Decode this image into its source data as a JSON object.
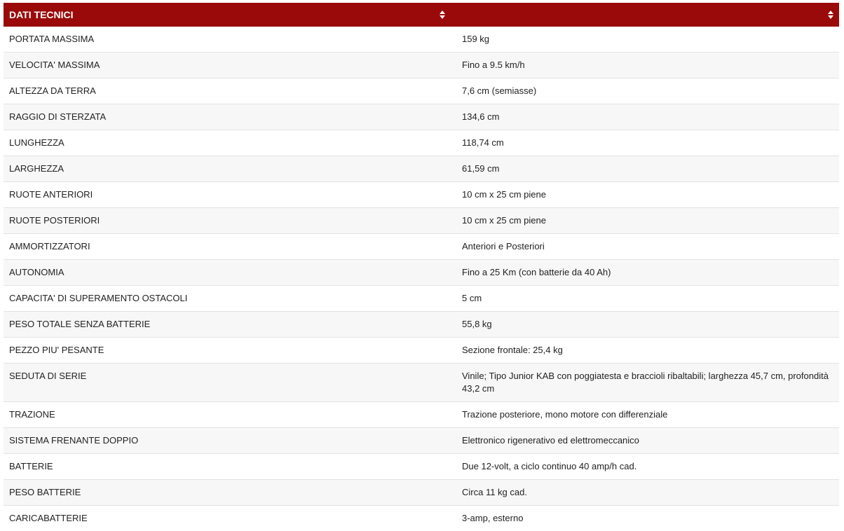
{
  "table": {
    "headers": [
      "DATI TECNICI",
      ""
    ],
    "rows": [
      {
        "label": "PORTATA MASSIMA",
        "value": "159 kg"
      },
      {
        "label": "VELOCITA' MASSIMA",
        "value": "Fino a 9.5 km/h"
      },
      {
        "label": "ALTEZZA DA TERRA",
        "value": "7,6 cm (semiasse)"
      },
      {
        "label": "RAGGIO DI STERZATA",
        "value": "134,6 cm"
      },
      {
        "label": "LUNGHEZZA",
        "value": "118,74 cm"
      },
      {
        "label": "LARGHEZZA",
        "value": "61,59 cm"
      },
      {
        "label": "RUOTE ANTERIORI",
        "value": "10 cm x 25 cm piene"
      },
      {
        "label": "RUOTE POSTERIORI",
        "value": "10 cm x 25 cm piene"
      },
      {
        "label": "AMMORTIZZATORI",
        "value": "Anteriori e Posteriori"
      },
      {
        "label": "AUTONOMIA",
        "value": "Fino a 25 Km (con batterie da 40 Ah)"
      },
      {
        "label": "CAPACITA' DI SUPERAMENTO OSTACOLI",
        "value": "5 cm"
      },
      {
        "label": "PESO TOTALE SENZA BATTERIE",
        "value": "55,8 kg"
      },
      {
        "label": "PEZZO PIU' PESANTE",
        "value": "Sezione frontale: 25,4 kg"
      },
      {
        "label": "SEDUTA DI SERIE",
        "value": "Vinile; Tipo Junior KAB con poggiatesta e braccioli ribaltabili; larghezza 45,7 cm, profondità 43,2 cm"
      },
      {
        "label": "TRAZIONE",
        "value": "Trazione posteriore, mono motore con differenziale"
      },
      {
        "label": "SISTEMA FRENANTE DOPPIO",
        "value": "Elettronico rigenerativo ed elettromeccanico"
      },
      {
        "label": "BATTERIE",
        "value": "Due 12-volt, a ciclo continuo 40 amp/h cad."
      },
      {
        "label": "PESO BATTERIE",
        "value": "Circa 11 kg cad."
      },
      {
        "label": "CARICABATTERIE",
        "value": "3-amp, esterno"
      }
    ]
  },
  "colors": {
    "header_bg": "#9b0a0a",
    "header_text": "#ffffff",
    "row_alt_bg": "#f7f7f7"
  },
  "icons": {
    "sort": "sort-icon"
  }
}
